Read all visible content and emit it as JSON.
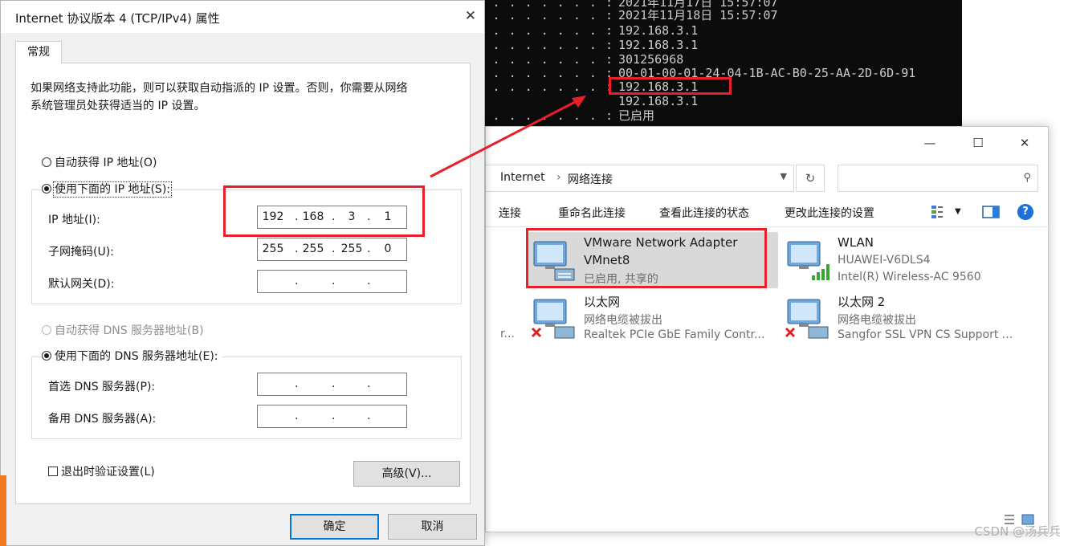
{
  "console": {
    "lines": [
      {
        "prefix": ". . . . . . . . . . . . . . :",
        "value": "2021年11月17日 15:57:07"
      },
      {
        "prefix": ". . . . . . . . . . . . . . :",
        "value": "2021年11月18日 15:57:07"
      },
      {
        "prefix": ". . . . . . . . . . . . . . :",
        "value": "192.168.3.1"
      },
      {
        "prefix": ". . . . . . . . . . . . . . :",
        "value": "192.168.3.1"
      },
      {
        "prefix": ". . . . . . . . . . . . . . :",
        "value": "301256968"
      },
      {
        "prefix": ". . . . . . . . . . . . . . :",
        "value": "00-01-00-01-24-04-1B-AC-B0-25-AA-2D-6D-91"
      },
      {
        "prefix": ". . . . . . . . . . . . . . :",
        "value": "192.168.3.1"
      },
      {
        "prefix": "",
        "value": "192.168.3.1"
      },
      {
        "prefix": ". . . . . . . . . . . . . . :",
        "value": "已启用"
      }
    ]
  },
  "explorer": {
    "win_min": "—",
    "win_max": "☐",
    "win_close": "✕",
    "breadcrumb": [
      "Internet",
      "›",
      "网络连接"
    ],
    "search_placeholder": "",
    "toolbar": {
      "item0": "连接",
      "item1": "重命名此连接",
      "item2": "查看此连接的状态",
      "item3": "更改此连接的设置",
      "help": "?"
    },
    "connections": [
      {
        "name": "VMware Network Adapter",
        "line2": "VMnet8",
        "line3": "已启用, 共享的"
      },
      {
        "name": "WLAN",
        "line2": "HUAWEI-V6DLS4",
        "line3": "Intel(R) Wireless-AC 9560"
      },
      {
        "name": "以太网",
        "line2": "网络电缆被拔出",
        "line3": "Realtek PCIe GbE Family Contr..."
      },
      {
        "name": "以太网 2",
        "line2": "网络电缆被拔出",
        "line3": "Sangfor SSL VPN CS Support ..."
      }
    ],
    "clipped_left": "r..."
  },
  "dialog": {
    "title": "Internet 协议版本 4 (TCP/IPv4) 属性",
    "close": "✕",
    "tab": "常规",
    "desc1": "如果网络支持此功能，则可以获取自动指派的 IP 设置。否则，你需要从网络",
    "desc2": "系统管理员处获得适当的 IP 设置。",
    "auto_ip": "自动获得 IP 地址(O)",
    "manual_ip": "使用下面的 IP 地址(S):",
    "ip_label": "IP 地址(I):",
    "ip": [
      "192",
      "168",
      "3",
      "1"
    ],
    "mask_label": "子网掩码(U):",
    "mask": [
      "255",
      "255",
      "255",
      "0"
    ],
    "gateway_label": "默认网关(D):",
    "gateway": [
      "",
      "",
      "",
      ""
    ],
    "auto_dns": "自动获得 DNS 服务器地址(B)",
    "manual_dns": "使用下面的 DNS 服务器地址(E):",
    "dns1_label": "首选 DNS 服务器(P):",
    "dns1": [
      "",
      "",
      "",
      ""
    ],
    "dns2_label": "备用 DNS 服务器(A):",
    "dns2": [
      "",
      "",
      "",
      ""
    ],
    "validate": "退出时验证设置(L)",
    "advanced": "高级(V)...",
    "ok": "确定",
    "cancel": "取消"
  },
  "watermark": "CSDN @汤兵兵",
  "colors": {
    "highlight": "#e8202a",
    "accent": "#0078d7",
    "console_bg": "#0c0c0c"
  }
}
